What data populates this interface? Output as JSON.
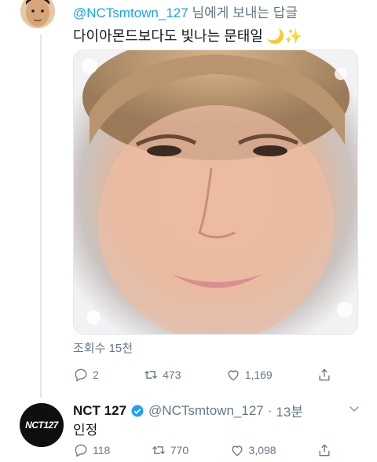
{
  "reply_tweet": {
    "handle": "@NCTsmtown_127",
    "reply_suffix": "님에게 보내는 답글",
    "text": "다이아몬드보다도 빛나는 문태일",
    "emoji": "🌙✨",
    "views": "조회수 15천",
    "reply_count": "2",
    "retweet_count": "473",
    "like_count": "1,169"
  },
  "main_tweet": {
    "name": "NCT 127",
    "handle": "@NCTsmtown_127",
    "separator": "·",
    "time": "13분",
    "text": "인정",
    "avatar_text": "NCT127",
    "reply_count": "118",
    "retweet_count": "770",
    "like_count": "3,098"
  },
  "colors": {
    "accent": "#1da1f2",
    "muted": "#657786",
    "text": "#14171a",
    "border": "#e1e8ed"
  },
  "icons": [
    "reply-icon",
    "retweet-icon",
    "like-icon",
    "share-icon",
    "verified-icon",
    "chevron-down-icon"
  ]
}
